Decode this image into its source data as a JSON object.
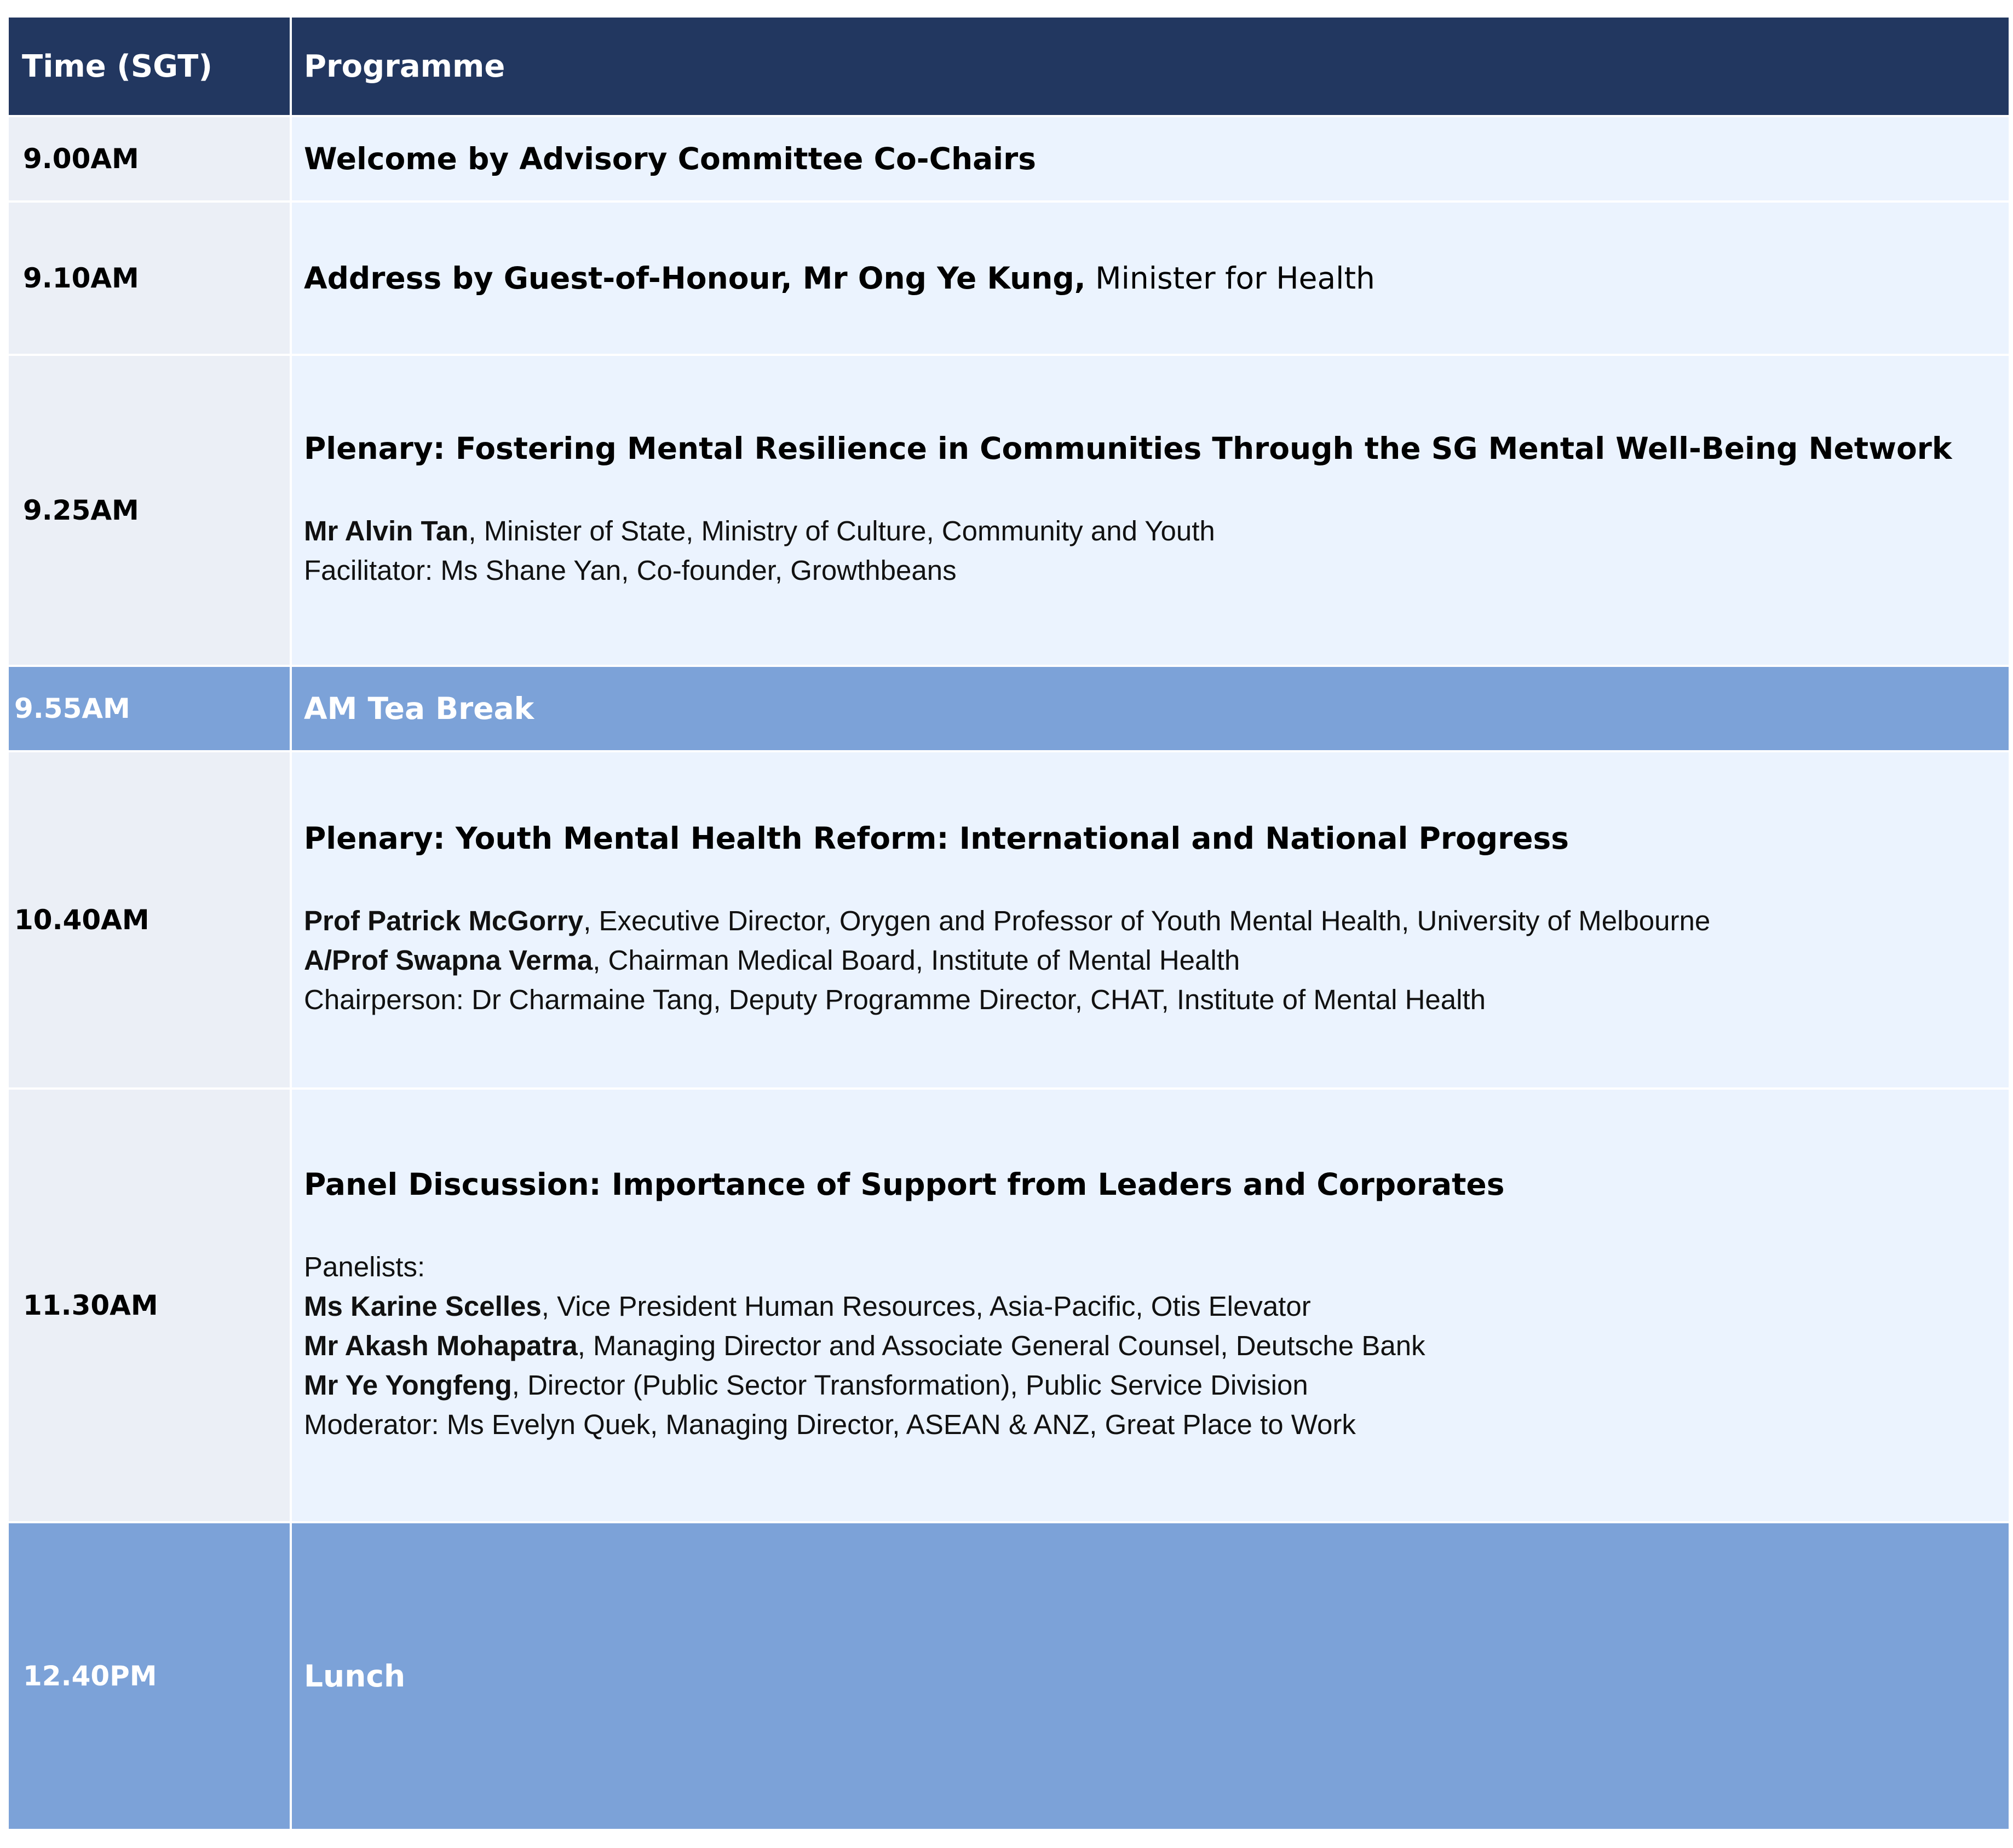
{
  "header": {
    "time": "Time (SGT)",
    "programme": "Programme"
  },
  "rows": [
    {
      "time": "9.00AM",
      "title": "Welcome by Advisory Committee Co-Chairs"
    },
    {
      "time": "9.10AM",
      "title": "Address by Guest-of-Honour, Mr Ong Ye Kung,",
      "title_suffix": " Minister for Health"
    },
    {
      "time": "9.25AM",
      "title": "Plenary: Fostering Mental Resilience in Communities Through the SG Mental Well-Being Network",
      "lines": [
        {
          "name": "Mr Alvin Tan",
          "text": ", Minister of State, Ministry of Culture, Community and Youth"
        },
        {
          "name": "",
          "text": "Facilitator: Ms Shane Yan, Co-founder, Growthbeans"
        }
      ]
    },
    {
      "time": "9.55AM",
      "title": "AM Tea Break"
    },
    {
      "time": "10.40AM",
      "title": "Plenary: Youth Mental Health Reform: International and National Progress",
      "lines": [
        {
          "name": "Prof Patrick McGorry",
          "text": ", Executive Director, Orygen and Professor of Youth Mental Health, University of Melbourne"
        },
        {
          "name": "A/Prof Swapna Verma",
          "text": ", Chairman Medical Board, Institute of Mental Health"
        },
        {
          "name": "",
          "text": "Chairperson: Dr Charmaine Tang, Deputy Programme Director, CHAT, Institute of Mental Health"
        }
      ]
    },
    {
      "time": "11.30AM",
      "title": "Panel Discussion: Importance of Support from Leaders and Corporates",
      "lines": [
        {
          "name": "",
          "text": "Panelists:"
        },
        {
          "name": "Ms Karine Scelles",
          "text": ", Vice President Human Resources, Asia-Pacific, Otis Elevator"
        },
        {
          "name": "Mr Akash Mohapatra",
          "text": ", Managing Director and Associate General Counsel, Deutsche Bank"
        },
        {
          "name": "Mr Ye Yongfeng",
          "text": ", Director (Public Sector Transformation), Public Service Division"
        },
        {
          "name": "",
          "text": "Moderator:  Ms Evelyn Quek, Managing Director, ASEAN & ANZ, Great Place to Work"
        }
      ]
    },
    {
      "time": "12.40PM",
      "title": "Lunch"
    }
  ],
  "colors": {
    "header_bg": "#223760",
    "row_bg": "#ebf3fe",
    "time_bg": "#ebeff6",
    "break_bg": "#7ca2d8"
  }
}
